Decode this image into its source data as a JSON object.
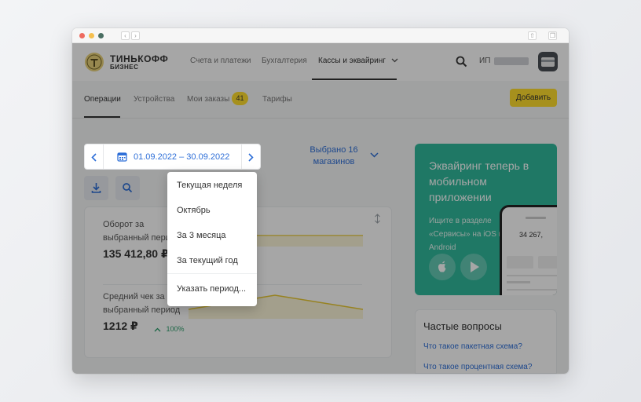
{
  "brand": {
    "line1": "ТИНЬКОФФ",
    "line2": "БИЗНЕС"
  },
  "main_nav": [
    {
      "label": "Счета и платежи"
    },
    {
      "label": "Бухгалтерия"
    },
    {
      "label": "Кассы и эквайринг"
    }
  ],
  "user": {
    "label": "ИП"
  },
  "sub_nav": [
    {
      "label": "Операции"
    },
    {
      "label": "Устройства"
    },
    {
      "label": "Мои заказы"
    },
    {
      "label": "Тарифы"
    }
  ],
  "orders_badge": "41",
  "add_button": "Добавить",
  "date_range": "01.09.2022 – 30.09.2022",
  "shops_selector": {
    "line1": "Выбрано 16",
    "line2": "магазинов"
  },
  "metrics": {
    "turnover_label": "Оборот за выбранный период",
    "turnover_value": "135 412,80 ₽",
    "avg_check_label": "Средний чек за выбранный период",
    "avg_check_value": "1212 ₽",
    "avg_check_change": "100%"
  },
  "promo": {
    "title": "Эквайринг теперь в мобильном приложении",
    "text": "Ищите в разделе «Сервисы» на iOS и Android",
    "phone_amount": "34 267,"
  },
  "faq": {
    "title": "Частые вопросы",
    "links": [
      "Что такое пакетная схема?",
      "Что такое процентная схема?"
    ]
  },
  "period_menu": [
    "Текущая неделя",
    "Октябрь",
    "За 3 месяца",
    "За текущий год",
    "Указать период..."
  ],
  "colors": {
    "accent_yellow": "#ffdd2d",
    "link_blue": "#2e6fd8",
    "promo_green": "#30b89b"
  }
}
